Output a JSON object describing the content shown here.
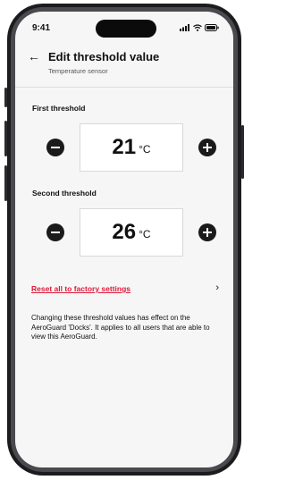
{
  "status_bar": {
    "time": "9:41"
  },
  "header": {
    "title": "Edit threshold value",
    "subtitle": "Temperature sensor"
  },
  "first_threshold": {
    "label": "First threshold",
    "value": "21",
    "unit": "°C"
  },
  "second_threshold": {
    "label": "Second threshold",
    "value": "26",
    "unit": "°C"
  },
  "reset": {
    "label": "Reset all to factory settings"
  },
  "info_text": "Changing these threshold values has effect on the AeroGuard 'Docks'. It applies to all users that are able to view this AeroGuard.",
  "icons": {
    "back": "arrow-left-icon",
    "decrement": "minus-circle-icon",
    "increment": "plus-circle-icon",
    "chevron": "chevron-right-icon",
    "signal": "signal-icon",
    "wifi": "wifi-icon",
    "battery": "battery-icon"
  },
  "colors": {
    "accent": "#e0193a",
    "text": "#111111",
    "background": "#f6f6f6"
  }
}
